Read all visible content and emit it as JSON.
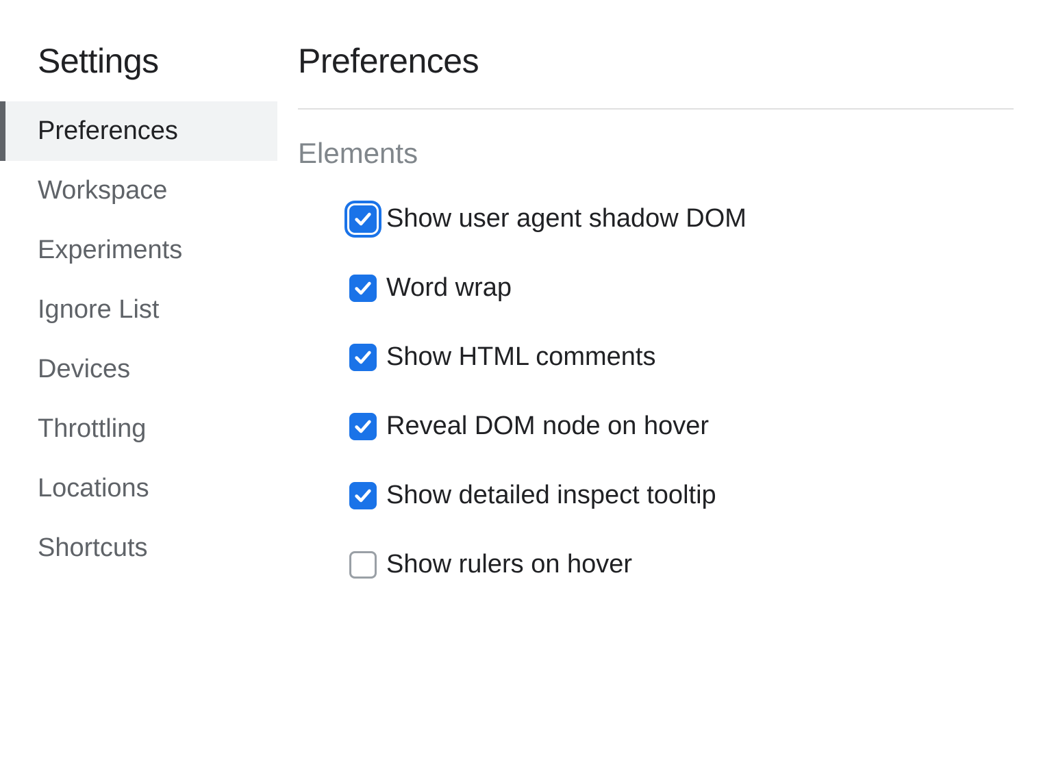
{
  "sidebar": {
    "title": "Settings",
    "items": [
      {
        "label": "Preferences",
        "active": true
      },
      {
        "label": "Workspace",
        "active": false
      },
      {
        "label": "Experiments",
        "active": false
      },
      {
        "label": "Ignore List",
        "active": false
      },
      {
        "label": "Devices",
        "active": false
      },
      {
        "label": "Throttling",
        "active": false
      },
      {
        "label": "Locations",
        "active": false
      },
      {
        "label": "Shortcuts",
        "active": false
      }
    ]
  },
  "main": {
    "title": "Preferences",
    "section_title": "Elements",
    "options": [
      {
        "label": "Show user agent shadow DOM",
        "checked": true,
        "focused": true
      },
      {
        "label": "Word wrap",
        "checked": true,
        "focused": false
      },
      {
        "label": "Show HTML comments",
        "checked": true,
        "focused": false
      },
      {
        "label": "Reveal DOM node on hover",
        "checked": true,
        "focused": false
      },
      {
        "label": "Show detailed inspect tooltip",
        "checked": true,
        "focused": false
      },
      {
        "label": "Show rulers on hover",
        "checked": false,
        "focused": false
      }
    ]
  }
}
